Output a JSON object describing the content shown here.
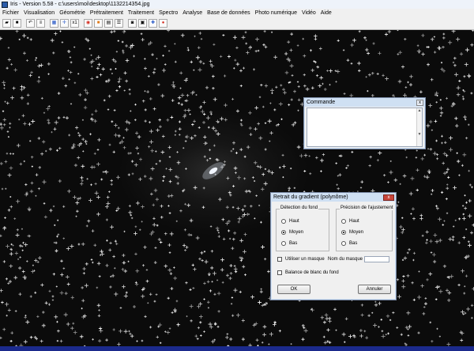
{
  "window": {
    "title": "Iris - Version 5.58 - c:\\users\\moi\\desktop\\1132214354.jpg"
  },
  "menu": [
    "Fichier",
    "Visualisation",
    "Géométrie",
    "Prétraitement",
    "Traitement",
    "Spectro",
    "Analyse",
    "Base de données",
    "Photo numérique",
    "Vidéo",
    "Aide"
  ],
  "toolbar": [
    {
      "icon": "open-folder-icon",
      "glyph": "▰"
    },
    {
      "icon": "save-icon",
      "glyph": "■"
    },
    {
      "icon": "undo-icon",
      "glyph": "↶"
    },
    {
      "icon": "sliders-icon",
      "glyph": "≡"
    },
    {
      "icon": "grid-icon",
      "glyph": "▦"
    },
    {
      "icon": "crosshair-icon",
      "glyph": "✛"
    },
    {
      "icon": "scale-icon",
      "glyph": "x1"
    },
    {
      "icon": "stop-icon",
      "glyph": "◉"
    },
    {
      "icon": "palette-icon",
      "glyph": "■"
    },
    {
      "icon": "panel-icon",
      "glyph": "▤"
    },
    {
      "icon": "list-icon",
      "glyph": "☰"
    },
    {
      "icon": "camera-icon",
      "glyph": "◙"
    },
    {
      "icon": "device-icon",
      "glyph": "▣"
    },
    {
      "icon": "star-icon",
      "glyph": "✚"
    },
    {
      "icon": "record-icon",
      "glyph": "●"
    }
  ],
  "colors": {
    "accent_red": "#d42b1e",
    "accent_blue": "#1c4fc4",
    "status_bar": "#1b2a8c"
  },
  "command_window": {
    "title": "Commande",
    "close": "x"
  },
  "gradient_dialog": {
    "title": "Retrait du gradient (polynôme)",
    "close": "x",
    "background_detection": {
      "label": "Détection du fond",
      "options": [
        "Haut",
        "Moyen",
        "Bas"
      ],
      "selected": "Moyen"
    },
    "fit_precision": {
      "label": "Précision de l'ajustement",
      "options": [
        "Haut",
        "Moyen",
        "Bas"
      ],
      "selected": "Moyen"
    },
    "use_mask_label": "Utiliser un masque",
    "use_mask_checked": false,
    "mask_name_label": "Nom du masque :",
    "mask_name_value": "",
    "white_balance_label": "Balance de blanc du fond",
    "white_balance_checked": false,
    "ok_label": "OK",
    "cancel_label": "Annuler"
  }
}
